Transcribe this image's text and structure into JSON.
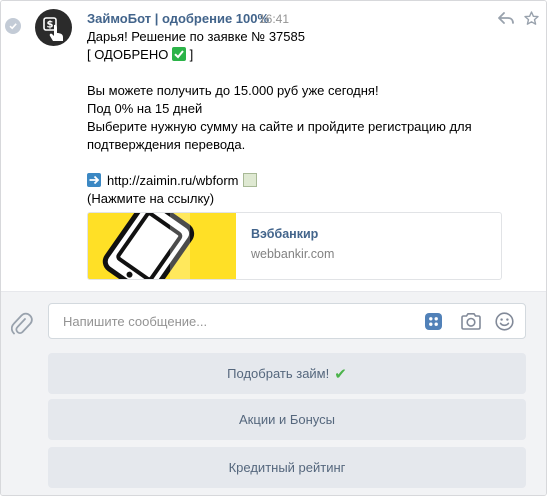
{
  "message": {
    "sender": "ЗаймоБот | одобрение 100%",
    "time": "16:41",
    "lines": {
      "l1": "Дарья! Решение по заявке № 37585",
      "l2_open": "[ ОДОБРЕНО ",
      "l2_close": " ]",
      "l3": "Вы можете получить до 15.000 руб уже сегодня!",
      "l4": "Под 0% на 15 дней",
      "l5": "Выберите нужную сумму на сайте и пройдите регистрацию для",
      "l6": "подтверждения перевода.",
      "link": "http://zaimin.ru/wbform",
      "note": "(Нажмите на ссылку)"
    },
    "icons": [
      "check-circle-icon",
      "avatar-hand-dollar-icon",
      "reply-icon",
      "star-icon",
      "check-mark-emoji-icon",
      "arrow-right-emoji-icon",
      "chart-emoji-icon"
    ]
  },
  "card": {
    "title": "Вэббанкир",
    "domain": "webbankir.com"
  },
  "composer": {
    "placeholder": "Напишите сообщение...",
    "icons": [
      "paperclip-icon",
      "keyboard-grid-icon",
      "camera-icon",
      "smile-icon"
    ]
  },
  "keyboard": {
    "buttons": [
      {
        "label": "Подобрать займ!",
        "emoji": "✔"
      },
      {
        "label": "Акции и Бонусы"
      },
      {
        "label": "Кредитный рейтинг"
      }
    ]
  },
  "colors": {
    "link": "#42648b",
    "button_bg": "#e5e8ed",
    "button_text": "#55677d",
    "composer_bg": "#f2f3f5"
  }
}
